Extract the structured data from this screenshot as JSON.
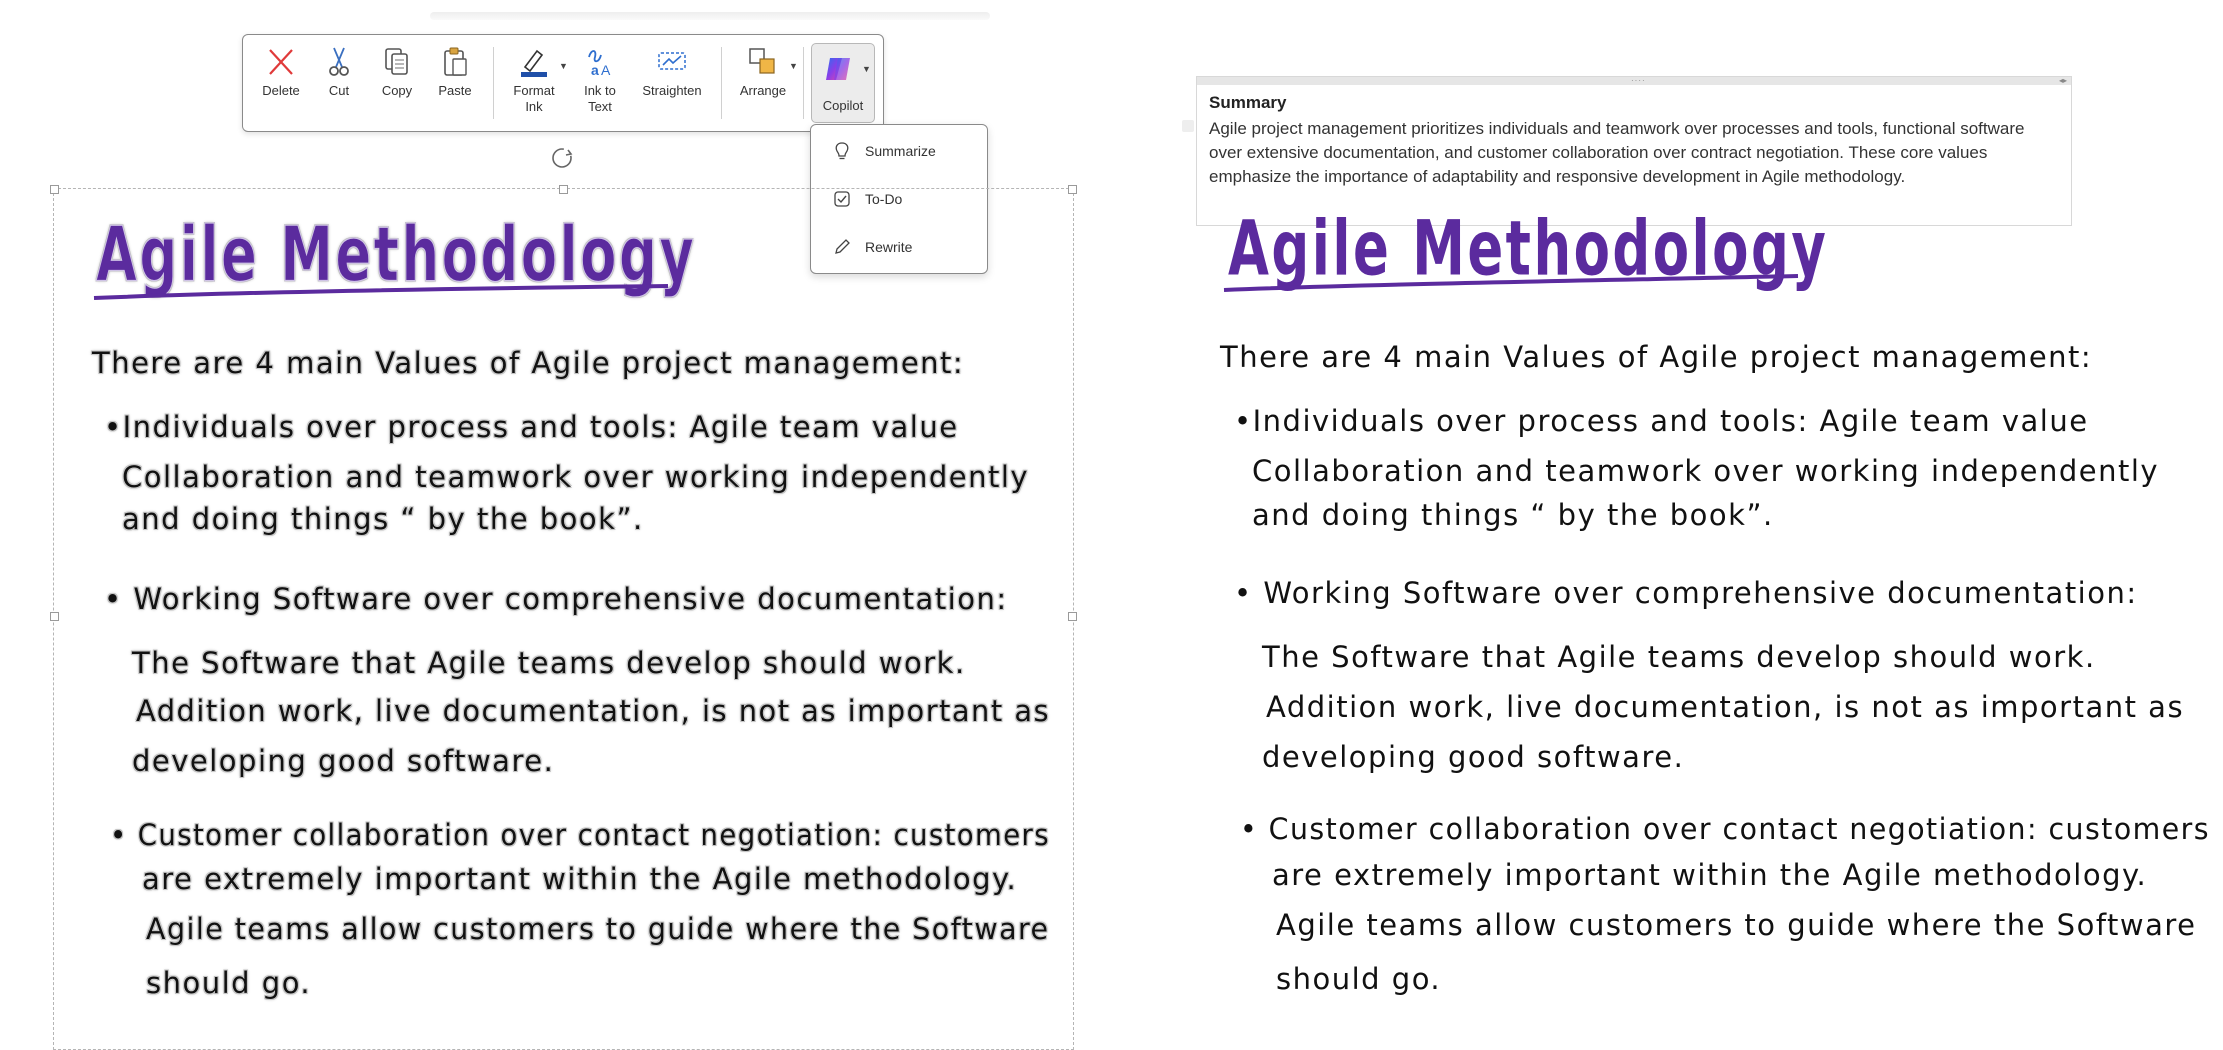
{
  "toolbar": {
    "delete_label": "Delete",
    "cut_label": "Cut",
    "copy_label": "Copy",
    "paste_label": "Paste",
    "format_ink_label_1": "Format",
    "format_ink_label_2": "Ink",
    "ink_to_text_label_1": "Ink to",
    "ink_to_text_label_2": "Text",
    "straighten_label": "Straighten",
    "arrange_label": "Arrange",
    "copilot_label": "Copilot"
  },
  "copilot_menu": {
    "items": [
      {
        "label": "Summarize",
        "icon": "lightbulb-icon"
      },
      {
        "label": "To-Do",
        "icon": "checkbox-icon"
      },
      {
        "label": "Rewrite",
        "icon": "pencil-icon"
      }
    ]
  },
  "note": {
    "title": "Agile Methodology",
    "lines": [
      "There are 4 main Values of Agile project management:",
      "•Individuals over process and tools: Agile team value",
      "Collaboration and teamwork over working independently",
      "and doing things “ by the book”.",
      "• Working Software over comprehensive documentation:",
      "The Software that Agile teams develop should work.",
      "Addition work, live documentation, is not as important as",
      "developing good software.",
      "• Customer collaboration over contact negotiation: customers",
      "are extremely important within the Agile methodology.",
      "Agile teams allow customers to guide where the Software",
      "should go."
    ]
  },
  "summary": {
    "title": "Summary",
    "body": "Agile project management prioritizes individuals and teamwork over processes and tools, functional software over extensive documentation, and customer collaboration over contract negotiation. These core values emphasize the importance of adaptability and responsive development in Agile methodology."
  },
  "colors": {
    "title_ink": "#5b2b9e",
    "delete_red": "#e03a3a",
    "accent_blue": "#2f6fcf"
  }
}
